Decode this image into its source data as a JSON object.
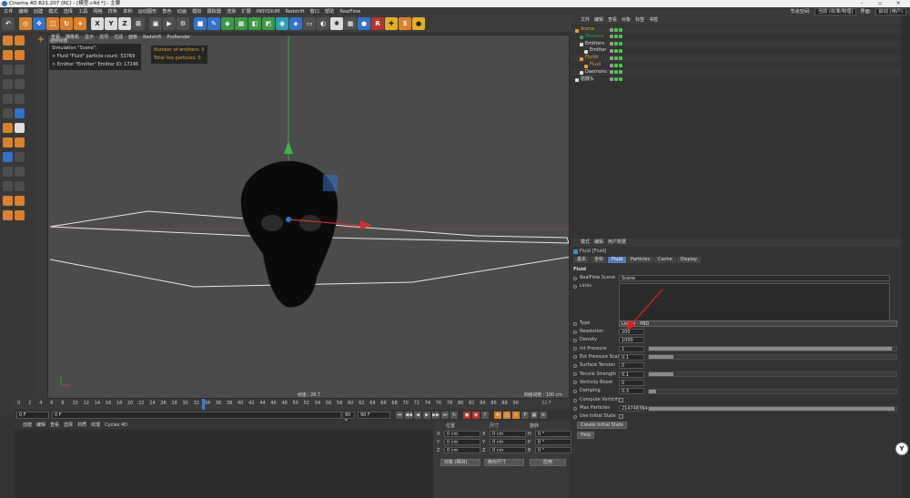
{
  "window": {
    "title": "Cinema 4D R21.207 (RC) - [模型.c4d *] - 主要"
  },
  "menubar": {
    "items": [
      "文件",
      "编辑",
      "创建",
      "模式",
      "选择",
      "工具",
      "网格",
      "样条",
      "体积",
      "运动图形",
      "角色",
      "动画",
      "模拟",
      "跟踪器",
      "渲染",
      "扩展",
      "INSYDIUM",
      "Redshift",
      "窗口",
      "帮助",
      "RealFlow"
    ],
    "node_space_label": "节点空间:",
    "node_space_value": "当前 (标准/物理)",
    "layout_label": "界面:",
    "layout_value": "启动 (用户)"
  },
  "toolbar": {
    "buttons": [
      "undo",
      "redo",
      "live-select",
      "move",
      "scale",
      "rotate",
      "recent",
      "X",
      "Y",
      "Z",
      "coord",
      "render-view",
      "render",
      "render-settings",
      "cube",
      "pen",
      "subdivision",
      "arrays",
      "boolean",
      "spline-mask",
      "field",
      "deformer",
      "floor",
      "camera",
      "light",
      "grid",
      "material",
      "redshift",
      "xparticles",
      "settings",
      "sphere"
    ]
  },
  "viewport": {
    "menu": [
      "查看",
      "摄像机",
      "显示",
      "选项",
      "过滤",
      "面板",
      "Redshift",
      "ProRender"
    ],
    "camera_label": "透视视图",
    "sim_info": [
      "Simulation \"Scene\":",
      "> Fluid \"Fluid\" particle count: 53769",
      "> Emitter \"Emitter\" Emitter ID: 17246"
    ],
    "emitter_info": [
      "Number of emitters: 0",
      "Total live particles: 0"
    ],
    "speed": "帧速 : 26.7",
    "grid_spacing": "网格间距 : 100 cm"
  },
  "timeline": {
    "ticks": [
      "0",
      "2",
      "4",
      "6",
      "8",
      "10",
      "12",
      "14",
      "16",
      "18",
      "20",
      "22",
      "24",
      "26",
      "28",
      "30",
      "32",
      "34",
      "36",
      "38",
      "40",
      "42",
      "44",
      "46",
      "48",
      "50",
      "52",
      "54",
      "56",
      "58",
      "60",
      "62",
      "64",
      "66",
      "68",
      "70",
      "72",
      "74",
      "76",
      "78",
      "80",
      "82",
      "84",
      "86",
      "88",
      "90"
    ],
    "current_frame": "32 F"
  },
  "playback": {
    "start": "0 F",
    "current": "0 F",
    "end": "90 F",
    "end2": "90 F"
  },
  "material": {
    "menu": [
      "创建",
      "编辑",
      "查看",
      "选择",
      "材质",
      "纹理",
      "Cycles 4D"
    ]
  },
  "coordinates": {
    "headers": [
      "位置",
      "尺寸",
      "旋转"
    ],
    "rows": [
      {
        "axis": "X",
        "pos": "0 cm",
        "size_axis": "X",
        "size": "0 cm",
        "rot_axis": "H",
        "rot": "0 °"
      },
      {
        "axis": "Y",
        "pos": "0 cm",
        "size_axis": "Y",
        "size": "0 cm",
        "rot_axis": "P",
        "rot": "0 °"
      },
      {
        "axis": "Z",
        "pos": "0 cm",
        "size_axis": "Z",
        "size": "0 cm",
        "rot_axis": "B",
        "rot": "0 °"
      }
    ],
    "mode": "对象 (相对)",
    "size_mode": "绝对尺寸",
    "apply": "应用"
  },
  "object_manager": {
    "menu": [
      "文件",
      "编辑",
      "查看",
      "对象",
      "标签",
      "书签"
    ],
    "objects": [
      {
        "name": "Scene",
        "color": "#e0a030",
        "indent": 0
      },
      {
        "name": "Meshers",
        "color": "#3a9a49",
        "indent": 1
      },
      {
        "name": "Emitters",
        "color": "#ddd",
        "indent": 1
      },
      {
        "name": "Emitter",
        "color": "#ddd",
        "indent": 2
      },
      {
        "name": "Fluids",
        "color": "#e0a030",
        "indent": 1
      },
      {
        "name": "Fluid",
        "color": "#e0a030",
        "indent": 2
      },
      {
        "name": "Daemons",
        "color": "#ddd",
        "indent": 1
      },
      {
        "name": "骷髅头",
        "color": "#ddd",
        "indent": 0
      }
    ]
  },
  "attribute_manager": {
    "menu": [
      "模式",
      "编辑",
      "用户数据"
    ],
    "object_label": "Fluid [Fluid]",
    "tabs": [
      "基本",
      "坐标",
      "Fluid",
      "Particles",
      "Cache",
      "Display"
    ],
    "active_tab": "Fluid",
    "section": "Fluid",
    "scene_label": "RealFlow Scene",
    "scene_value": "Scene",
    "links_label": "Links",
    "type_label": "Type",
    "type_value": "Liquid - PBD",
    "params": [
      {
        "label": "Resolution",
        "value": "200"
      },
      {
        "label": "Density",
        "value": "1000"
      },
      {
        "label": "Int Pressure",
        "value": "1",
        "fill": 0.98
      },
      {
        "label": "Ext Pressure Scale",
        "value": "0.1",
        "fill": 0.1
      },
      {
        "label": "Surface Tension",
        "value": "0"
      },
      {
        "label": "Tensile Strength",
        "value": "0.1",
        "fill": 0.1
      },
      {
        "label": "Vorticity Boost",
        "value": "0"
      },
      {
        "label": "Damping",
        "value": "0.3",
        "fill": 0.03
      }
    ],
    "compute_vorticity": "Compute Vorticity",
    "max_particles_label": "Max Particles",
    "max_particles": "2147483647",
    "use_initial_state": "Use Initial State",
    "create_initial_state": "Create Initial State",
    "help": "Help"
  }
}
